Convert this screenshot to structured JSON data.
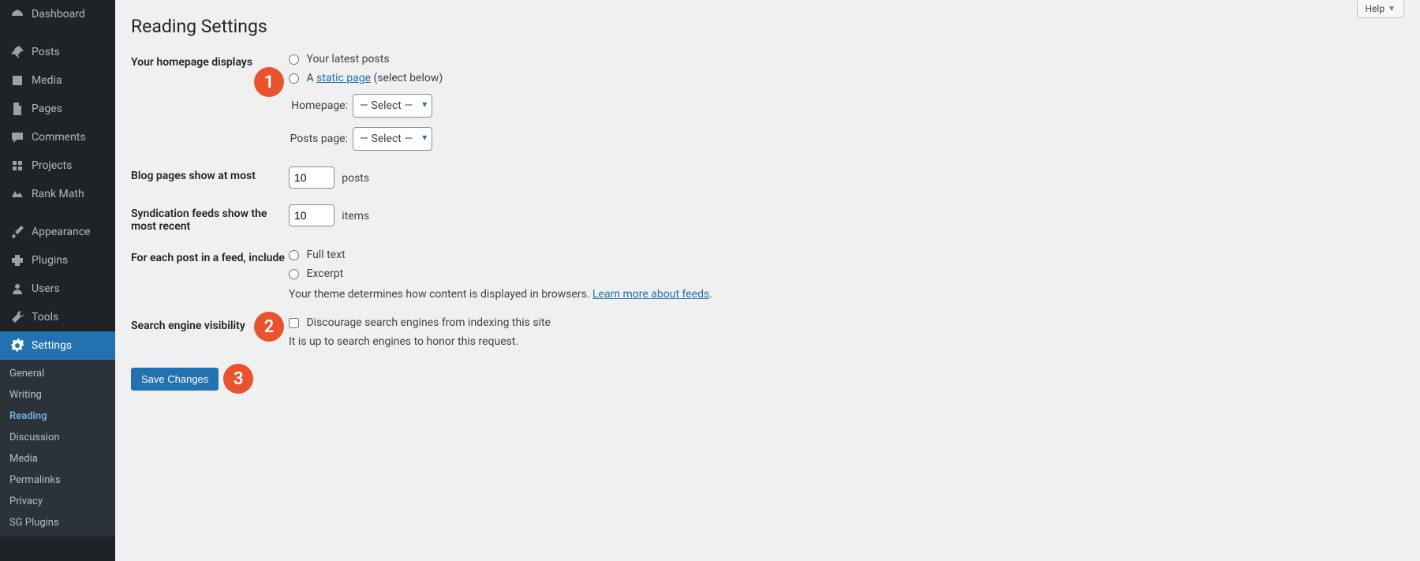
{
  "sidebar": {
    "items": [
      {
        "label": "Dashboard",
        "icon": "dashboard"
      },
      {
        "label": "Posts",
        "icon": "pin"
      },
      {
        "label": "Media",
        "icon": "media"
      },
      {
        "label": "Pages",
        "icon": "page"
      },
      {
        "label": "Comments",
        "icon": "comment"
      },
      {
        "label": "Projects",
        "icon": "project"
      },
      {
        "label": "Rank Math",
        "icon": "rankmath"
      },
      {
        "label": "Appearance",
        "icon": "brush"
      },
      {
        "label": "Plugins",
        "icon": "plugin"
      },
      {
        "label": "Users",
        "icon": "user"
      },
      {
        "label": "Tools",
        "icon": "tool"
      },
      {
        "label": "Settings",
        "icon": "gear",
        "active": true
      }
    ],
    "submenu": [
      {
        "label": "General"
      },
      {
        "label": "Writing"
      },
      {
        "label": "Reading",
        "current": true
      },
      {
        "label": "Discussion"
      },
      {
        "label": "Media"
      },
      {
        "label": "Permalinks"
      },
      {
        "label": "Privacy"
      },
      {
        "label": "SG Plugins"
      }
    ]
  },
  "header": {
    "title": "Reading Settings",
    "help_label": "Help"
  },
  "homepage": {
    "row_label": "Your homepage displays",
    "opt_latest": "Your latest posts",
    "opt_static_prefix": "A ",
    "opt_static_link": "static page",
    "opt_static_suffix": " (select below)",
    "homepage_label": "Homepage:",
    "homepage_value": "— Select —",
    "posts_page_label": "Posts page:",
    "posts_page_value": "— Select —",
    "badge": "1"
  },
  "blog_pages": {
    "row_label": "Blog pages show at most",
    "value": "10",
    "suffix": "posts"
  },
  "syndication": {
    "row_label": "Syndication feeds show the most recent",
    "value": "10",
    "suffix": "items"
  },
  "feed_include": {
    "row_label": "For each post in a feed, include",
    "opt_full": "Full text",
    "opt_excerpt": "Excerpt",
    "note_prefix": "Your theme determines how content is displayed in browsers. ",
    "note_link": "Learn more about feeds",
    "note_suffix": "."
  },
  "search_engine": {
    "row_label": "Search engine visibility",
    "checkbox_label": "Discourage search engines from indexing this site",
    "note": "It is up to search engines to honor this request.",
    "badge": "2"
  },
  "save": {
    "button_label": "Save Changes",
    "badge": "3"
  }
}
